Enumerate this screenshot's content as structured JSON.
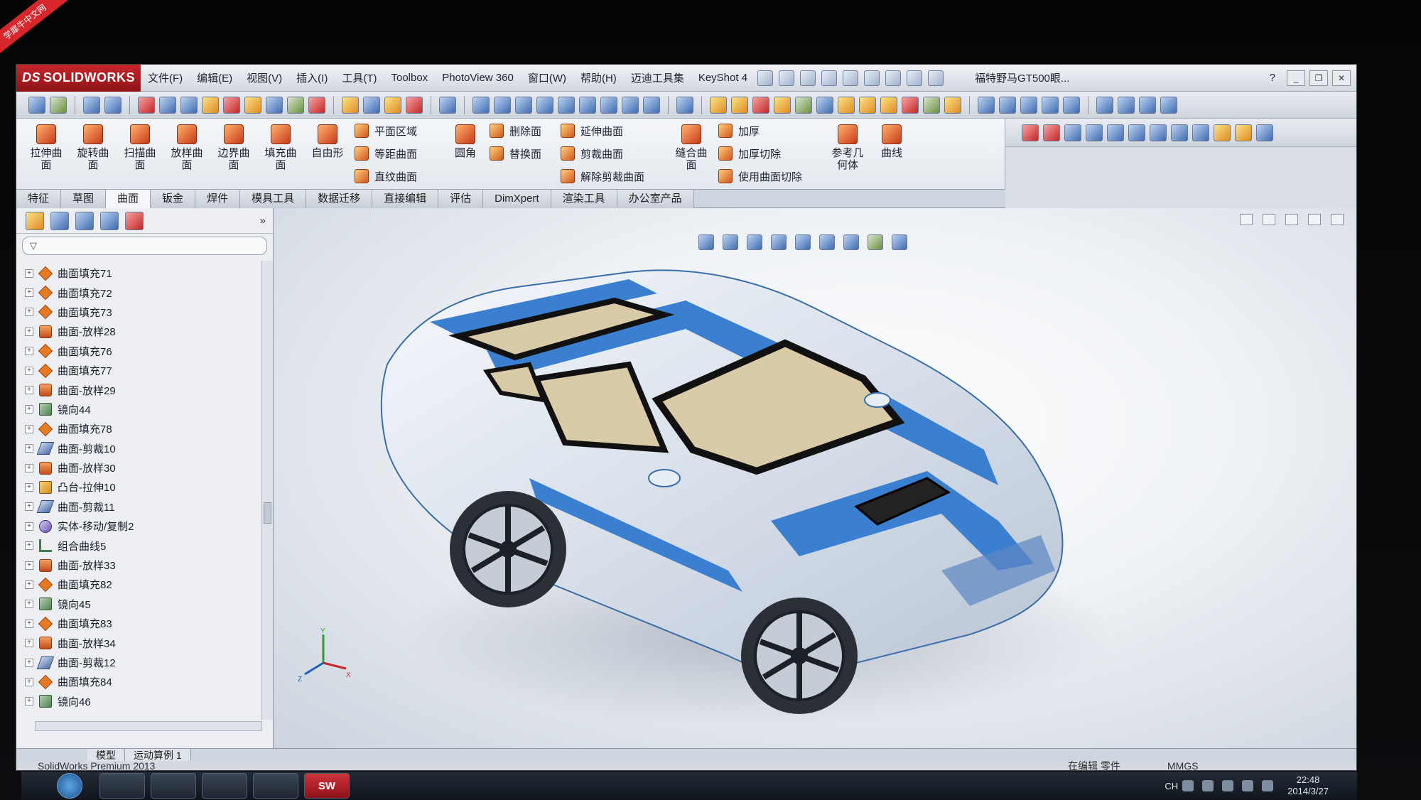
{
  "badge": "学犀牛中文网",
  "app": {
    "logo": "SOLIDWORKS",
    "menu": [
      "文件(F)",
      "编辑(E)",
      "视图(V)",
      "插入(I)",
      "工具(T)",
      "Toolbox",
      "PhotoView 360",
      "窗口(W)",
      "帮助(H)",
      "迈迪工具集",
      "KeyShot 4"
    ],
    "doc_title": "福特野马GT500眼...",
    "help": "?"
  },
  "ribbon": {
    "big_buttons": [
      {
        "label": "拉伸曲\n面",
        "icon": "extruded-surface-icon"
      },
      {
        "label": "旋转曲\n面",
        "icon": "revolved-surface-icon"
      },
      {
        "label": "扫描曲\n面",
        "icon": "swept-surface-icon"
      },
      {
        "label": "放样曲\n面",
        "icon": "lofted-surface-icon"
      },
      {
        "label": "边界曲\n面",
        "icon": "boundary-surface-icon"
      },
      {
        "label": "填充曲\n面",
        "icon": "filled-surface-icon"
      },
      {
        "label": "自由形",
        "icon": "freeform-icon"
      }
    ],
    "col2": [
      "平面区域",
      "等距曲面",
      "直纹曲面"
    ],
    "fillet": "圆角",
    "col3": [
      "删除面",
      "替换面"
    ],
    "col4": [
      "延伸曲面",
      "剪裁曲面",
      "解除剪裁曲面"
    ],
    "knit": "缝合曲\n面",
    "col5": [
      "加厚",
      "加厚切除",
      "使用曲面切除"
    ],
    "ref_geometry": "参考几\n何体",
    "curves": "曲线"
  },
  "tabs": [
    "特征",
    "草图",
    "曲面",
    "钣金",
    "焊件",
    "模具工具",
    "数据迁移",
    "直接编辑",
    "评估",
    "DimXpert",
    "渲染工具",
    "办公室产品"
  ],
  "active_tab": "曲面",
  "tree": [
    {
      "label": "曲面填充71",
      "icon": "fill"
    },
    {
      "label": "曲面填充72",
      "icon": "fill"
    },
    {
      "label": "曲面填充73",
      "icon": "fill"
    },
    {
      "label": "曲面-放样28",
      "icon": "loft"
    },
    {
      "label": "曲面填充76",
      "icon": "fill"
    },
    {
      "label": "曲面填充77",
      "icon": "fill"
    },
    {
      "label": "曲面-放样29",
      "icon": "loft"
    },
    {
      "label": "镜向44",
      "icon": "mirror"
    },
    {
      "label": "曲面填充78",
      "icon": "fill"
    },
    {
      "label": "曲面-剪裁10",
      "icon": "trim"
    },
    {
      "label": "曲面-放样30",
      "icon": "loft"
    },
    {
      "label": "凸台-拉伸10",
      "icon": "boss"
    },
    {
      "label": "曲面-剪裁11",
      "icon": "trim"
    },
    {
      "label": "实体-移动/复制2",
      "icon": "move"
    },
    {
      "label": "组合曲线5",
      "icon": "curve"
    },
    {
      "label": "曲面-放样33",
      "icon": "loft"
    },
    {
      "label": "曲面填充82",
      "icon": "fill"
    },
    {
      "label": "镜向45",
      "icon": "mirror"
    },
    {
      "label": "曲面填充83",
      "icon": "fill"
    },
    {
      "label": "曲面-放样34",
      "icon": "loft"
    },
    {
      "label": "曲面-剪裁12",
      "icon": "trim"
    },
    {
      "label": "曲面填充84",
      "icon": "fill"
    },
    {
      "label": "镜向46",
      "icon": "mirror"
    }
  ],
  "model_tabs": [
    "模型",
    "运动算例 1"
  ],
  "status": {
    "left": "SolidWorks Premium 2013",
    "mode": "在编辑 零件",
    "units": "MMGS"
  },
  "taskbar": {
    "sw_label": "SW",
    "lang": "CH",
    "time": "22:48",
    "date": "2014/3/27"
  },
  "colors": {
    "stripe": "#3b7fd0",
    "glass": "#d9cba8",
    "body": "#e8eef6",
    "brand_red": "#c6252b"
  }
}
